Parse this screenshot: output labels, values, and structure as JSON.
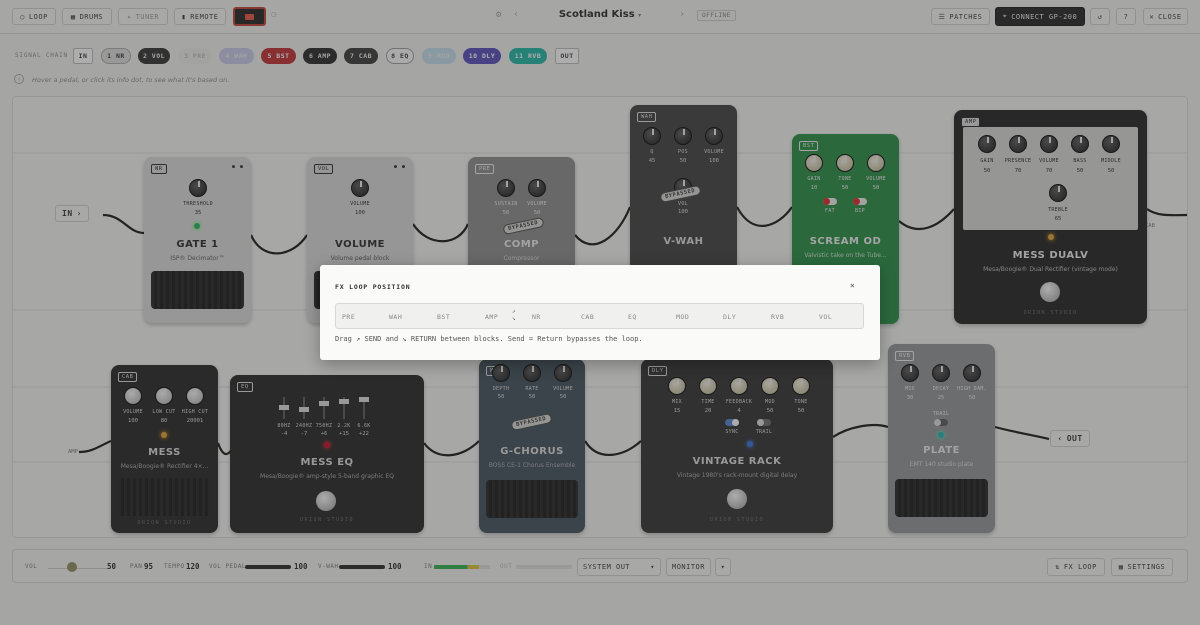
{
  "toolbar": {
    "loop": "LOOP",
    "drums": "DRUMS",
    "tuner": "TUNER",
    "remote": "REMOTE",
    "patch_name": "Scotland Kiss",
    "offline": "OFFLINE",
    "patches": "PATCHES",
    "connect": "CONNECT GP-200",
    "close": "CLOSE"
  },
  "chain": {
    "label": "SIGNAL CHAIN",
    "items": [
      "IN",
      "1 NR",
      "2 VOL",
      "3 PRE",
      "4 WAH",
      "5 BST",
      "6 AMP",
      "7 CAB",
      "8 EQ",
      "9 MOD",
      "10 DLY",
      "11 RVB",
      "OUT"
    ]
  },
  "hint": "Hover a pedal, or click its info dot, to see what it's based on.",
  "io": {
    "in": "IN",
    "out": "OUT",
    "amp_port": "AMP",
    "cab_port": "CAB"
  },
  "pedals": {
    "gate": {
      "tag": "NR",
      "knob": "THRESHOLD",
      "value": "35",
      "name": "GATE 1",
      "desc": "ISP® Decimator™"
    },
    "volume": {
      "tag": "VOL",
      "knob": "VOLUME",
      "value": "100",
      "name": "VOLUME",
      "desc": "Volume pedal block"
    },
    "comp": {
      "tag": "PRE",
      "k1": "SUSTAIN",
      "v1": "50",
      "k2": "VOLUME",
      "v2": "50",
      "name": "COMP",
      "desc": "Compressor",
      "stamp": "BYPASSED"
    },
    "vwah": {
      "tag": "WAH",
      "k1": "Q",
      "v1": "45",
      "k2": "POS",
      "v2": "50",
      "k3": "VOLUME",
      "v3": "100",
      "k4": "VOL",
      "v4": "100",
      "name": "V-WAH",
      "stamp": "BYPASSED"
    },
    "scream": {
      "tag": "BST",
      "k1": "GAIN",
      "v1": "10",
      "k2": "TONE",
      "v2": "50",
      "k3": "VOLUME",
      "v3": "50",
      "sw1": "FAT",
      "sw2": "BIP",
      "name": "SCREAM OD",
      "desc": "Valvistic take on the Tube..."
    },
    "amp": {
      "tag": "AMP",
      "k1": "GAIN",
      "v1": "50",
      "k2": "PRESENCE",
      "v2": "70",
      "k3": "VOLUME",
      "v3": "70",
      "k4": "BASS",
      "v4": "50",
      "k5": "MIDDLE",
      "v5": "50",
      "k6": "TREBLE",
      "v6": "65",
      "name": "MESS DUALV",
      "desc": "Mesa/Boogie® Dual Rectifier (vintage mode)",
      "brand": "ORION STUDIO"
    },
    "cab": {
      "tag": "CAB",
      "k1": "VOLUME",
      "v1": "100",
      "k2": "LOW CUT",
      "v2": "80",
      "k3": "HIGH CUT",
      "v3": "20001",
      "name": "MESS",
      "desc": "Mesa/Boogie® Rectifier 4×...",
      "brand": "ORION STUDIO"
    },
    "eq": {
      "tag": "EQ",
      "bands": [
        "80HZ",
        "240HZ",
        "750HZ",
        "2.2K",
        "6.6K"
      ],
      "vals": [
        "-4",
        "-7",
        "+6",
        "+15",
        "+22"
      ],
      "name": "MESS EQ",
      "desc": "Mesa/Boogie® amp-style 5-band graphic EQ",
      "brand": "ORION STUDIO"
    },
    "chorus": {
      "tag": "MOD",
      "k1": "DEPTH",
      "v1": "50",
      "k2": "RATE",
      "v2": "50",
      "k3": "VOLUME",
      "v3": "50",
      "name": "G-CHORUS",
      "desc": "BOSS CE-1 Chorus Ensemble",
      "stamp": "BYPASSED"
    },
    "delay": {
      "tag": "DLY",
      "k1": "MIX",
      "v1": "15",
      "k2": "TIME",
      "v2": "20",
      "k3": "FEEDBACK",
      "v3": "4",
      "k4": "MOD",
      "v4": "50",
      "k5": "TONE",
      "v5": "50",
      "sw1": "SYNC",
      "sw2": "TRAIL",
      "name": "VINTAGE RACK",
      "desc": "Vintage 1980's rack-mount digital delay",
      "brand": "ORION STUDIO"
    },
    "plate": {
      "tag": "RVB",
      "k1": "MIX",
      "v1": "30",
      "k2": "DECAY",
      "v2": "25",
      "k3": "HIGH DAM.",
      "v3": "50",
      "sw1": "TRAIL",
      "name": "PLATE",
      "desc": "EMT 140 studio plate"
    }
  },
  "modal": {
    "title": "FX LOOP POSITION",
    "slots": [
      "PRE",
      "WAH",
      "BST",
      "AMP",
      "NR",
      "CAB",
      "EQ",
      "MOD",
      "DLY",
      "RVB",
      "VOL"
    ],
    "note": "Drag ↗ SEND and ↘ RETURN between blocks. Send = Return bypasses the loop."
  },
  "bottom": {
    "vol_lbl": "VOL",
    "vol_val": "50",
    "pan_lbl": "PAN",
    "pan_val": "95",
    "tempo_lbl": "TEMPO",
    "tempo_val": "120",
    "volpedal_lbl": "VOL PEDAL",
    "volpedal_val": "100",
    "vwah_lbl": "V-WAH",
    "vwah_val": "100",
    "in_lbl": "IN",
    "out_lbl": "OUT",
    "output_select": "SYSTEM OUT",
    "monitor": "MONITOR",
    "fxloop": "FX LOOP",
    "settings": "SETTINGS"
  }
}
